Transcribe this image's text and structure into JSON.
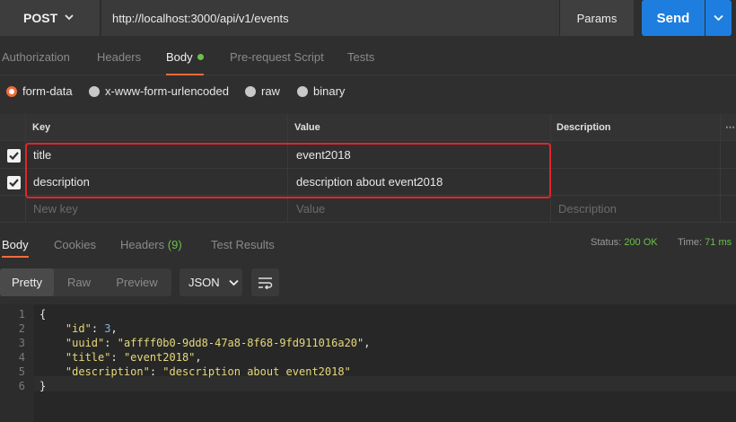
{
  "request": {
    "method": "POST",
    "url": "http://localhost:3000/api/v1/events",
    "params_label": "Params",
    "send_label": "Send"
  },
  "request_tabs": [
    "Authorization",
    "Headers",
    "Body",
    "Pre-request Script",
    "Tests"
  ],
  "body_types": [
    "form-data",
    "x-www-form-urlencoded",
    "raw",
    "binary"
  ],
  "table": {
    "headers": {
      "key": "Key",
      "value": "Value",
      "description": "Description"
    },
    "rows": [
      {
        "key": "title",
        "value": "event2018",
        "description": ""
      },
      {
        "key": "description",
        "value": "description about event2018",
        "description": ""
      }
    ],
    "placeholder": {
      "key": "New key",
      "value": "Value",
      "description": "Description"
    }
  },
  "response_tabs": {
    "body": "Body",
    "cookies": "Cookies",
    "headers": "Headers",
    "headers_count": "(9)",
    "test_results": "Test Results"
  },
  "status": {
    "label": "Status:",
    "value": "200 OK",
    "time_label": "Time:",
    "time_value": "71 ms"
  },
  "view_modes": [
    "Pretty",
    "Raw",
    "Preview"
  ],
  "format": "JSON",
  "code": {
    "line_numbers": [
      "1",
      "2",
      "3",
      "4",
      "5",
      "6"
    ],
    "lines": {
      "l1": "{",
      "id_key": "\"id\"",
      "id_val": "3",
      "uuid_key": "\"uuid\"",
      "uuid_val": "\"affff0b0-9dd8-47a8-8f68-9fd911016a20\"",
      "title_key": "\"title\"",
      "title_val": "\"event2018\"",
      "desc_key": "\"description\"",
      "desc_val": "\"description about event2018\"",
      "l6": "}"
    }
  },
  "colors": {
    "accent": "#f26b3a",
    "send": "#1d7ee0",
    "ok": "#6bc04b",
    "highlight": "#e0262a"
  }
}
